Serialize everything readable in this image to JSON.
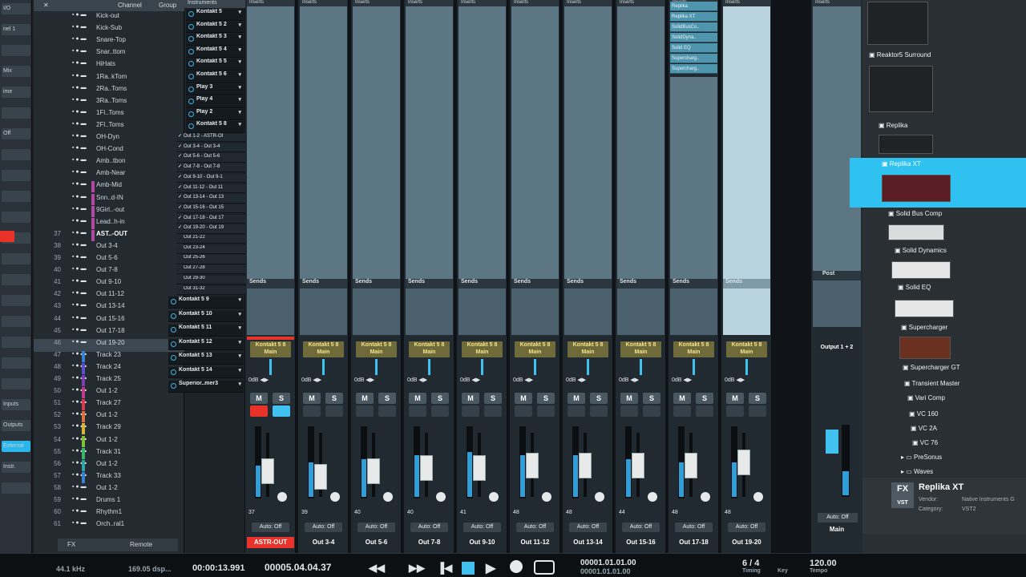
{
  "left_panel": {
    "labels": [
      "I/O",
      "nel 1",
      "",
      "Mix",
      "ime",
      "",
      "Off",
      "",
      "",
      "",
      "",
      "",
      "",
      "",
      "",
      "",
      "",
      "",
      "",
      "Inputs",
      "Outputs",
      "External",
      "Instr.",
      ""
    ]
  },
  "channel_list": {
    "header": {
      "close": "✕",
      "channel": "Channel",
      "group": "Group"
    },
    "rows": [
      {
        "num": "",
        "name": "Kick-out"
      },
      {
        "num": "",
        "name": "Kick-Sub"
      },
      {
        "num": "",
        "name": "Snare-Top"
      },
      {
        "num": "",
        "name": "Snar..ttom"
      },
      {
        "num": "",
        "name": "HiHats"
      },
      {
        "num": "",
        "name": "1Ra..kTom"
      },
      {
        "num": "",
        "name": "2Ra..Toms"
      },
      {
        "num": "",
        "name": "3Ra..Toms"
      },
      {
        "num": "",
        "name": "1Fl..Toms"
      },
      {
        "num": "",
        "name": "2Fl..Toms"
      },
      {
        "num": "",
        "name": "OH-Dyn"
      },
      {
        "num": "",
        "name": "OH-Cond"
      },
      {
        "num": "",
        "name": "Amb..tbon"
      },
      {
        "num": "",
        "name": "Amb-Near"
      },
      {
        "num": "",
        "name": "Amb-Mid"
      },
      {
        "num": "",
        "name": "Snn..d-IN"
      },
      {
        "num": "",
        "name": "9Girl..-out"
      },
      {
        "num": "",
        "name": "Lead..h-in"
      },
      {
        "num": "37",
        "name": "AST..-OUT"
      },
      {
        "num": "38",
        "name": "Out 3-4"
      },
      {
        "num": "39",
        "name": "Out 5-6"
      },
      {
        "num": "40",
        "name": "Out 7-8"
      },
      {
        "num": "41",
        "name": "Out 9-10"
      },
      {
        "num": "42",
        "name": "Out 11-12"
      },
      {
        "num": "43",
        "name": "Out 13-14"
      },
      {
        "num": "44",
        "name": "Out 15-16"
      },
      {
        "num": "45",
        "name": "Out 17-18"
      },
      {
        "num": "46",
        "name": "Out 19-20"
      },
      {
        "num": "47",
        "name": "Track 23"
      },
      {
        "num": "48",
        "name": "Track 24"
      },
      {
        "num": "49",
        "name": "Track 25"
      },
      {
        "num": "50",
        "name": "Out 1-2"
      },
      {
        "num": "51",
        "name": "Track 27"
      },
      {
        "num": "52",
        "name": "Out 1-2"
      },
      {
        "num": "53",
        "name": "Track 29"
      },
      {
        "num": "54",
        "name": "Out 1-2"
      },
      {
        "num": "55",
        "name": "Track 31"
      },
      {
        "num": "56",
        "name": "Out 1-2"
      },
      {
        "num": "57",
        "name": "Track 33"
      },
      {
        "num": "58",
        "name": "Out 1-2"
      },
      {
        "num": "59",
        "name": "Drums 1"
      },
      {
        "num": "60",
        "name": "Rhythm1"
      },
      {
        "num": "61",
        "name": "Orch..ral1"
      }
    ],
    "footer": {
      "remote": "Remote",
      "fx": "FX"
    }
  },
  "instruments": {
    "header": "Instruments",
    "items_top": [
      "Kontakt 5",
      "Kontakt 5 2",
      "Kontakt 5 3",
      "Kontakt 5 4",
      "Kontakt 5 5",
      "Kontakt 5 6",
      "Play 3",
      "Play 4",
      "Play 2",
      "Kontakt 5 8"
    ],
    "outputs": [
      "Out 1-2 - ASTR-OI",
      "Out 3-4 - Out 3-4",
      "Out 5-6 - Out 5-6",
      "Out 7-8 - Out 7-8",
      "Out 9-10 - Out 9-1",
      "Out 11-12 - Out 11",
      "Out 13-14 - Out 13",
      "Out 15-16 - Out 15",
      "Out 17-18 - Out 17",
      "Out 19-20 - Out 19",
      "Out 21-22",
      "Out 23-24",
      "Out 25-26",
      "Out 27-28",
      "Out 29-30",
      "Out 31-32"
    ],
    "checked_count": 10,
    "items_bottom": [
      "Kontakt 5 9",
      "Kontakt 5 10",
      "Kontakt 5 11",
      "Kontakt 5 12",
      "Kontakt 5 13",
      "Kontakt 5 14",
      "Superior..mer3"
    ]
  },
  "mixer": {
    "inserts_label": "Inserts",
    "sends_label": "Sends",
    "main_label": "Main",
    "auto_label": "Auto: Off",
    "m_label": "M",
    "s_label": "S",
    "strips": [
      {
        "bus": "Kontakt 5 8",
        "volume": "37",
        "out": "ASTR-OUT",
        "out_color": "#e8322a",
        "fader": 0.55,
        "meter": 0.45
      },
      {
        "bus": "Kontakt 5 8",
        "volume": "39",
        "out": "Out 3-4",
        "out_color": "",
        "fader": 0.45,
        "meter": 0.5
      },
      {
        "bus": "Kontakt 5 8",
        "volume": "40",
        "out": "Out 5-6",
        "out_color": "",
        "fader": 0.55,
        "meter": 0.55
      },
      {
        "bus": "Kontakt 5 8",
        "volume": "40",
        "out": "Out 7-8",
        "out_color": "",
        "fader": 0.6,
        "meter": 0.6
      },
      {
        "bus": "Kontakt 5 8",
        "volume": "41",
        "out": "Out 9-10",
        "out_color": "",
        "fader": 0.6,
        "meter": 0.65
      },
      {
        "bus": "Kontakt 5 8",
        "volume": "48",
        "out": "Out 11-12",
        "out_color": "",
        "fader": 0.65,
        "meter": 0.6
      },
      {
        "bus": "Kontakt 5 8",
        "volume": "48",
        "out": "Out 13-14",
        "out_color": "",
        "fader": 0.65,
        "meter": 0.6
      },
      {
        "bus": "Kontakt 5 8",
        "volume": "44",
        "out": "Out 15-16",
        "out_color": "",
        "fader": 0.65,
        "meter": 0.55
      },
      {
        "bus": "Kontakt 5 8",
        "volume": "48",
        "out": "Out 17-18",
        "out_color": "",
        "fader": 0.65,
        "meter": 0.5
      },
      {
        "bus": "Kontakt 5 8",
        "volume": "48",
        "out": "Out 19-20",
        "out_color": "",
        "fader": 0.7,
        "meter": 0.5
      }
    ],
    "fx_slots": [
      "Replika",
      "Replika XT",
      "SolidBusCo..",
      "SolidDyna..",
      "Solid EQ",
      "Supercharg..",
      "Supercharg.."
    ],
    "main_out": {
      "inserts": "Inserts",
      "post": "Post",
      "output": "Output 1 + 2",
      "auto": "Auto: Off",
      "label": "Main"
    }
  },
  "browser": {
    "items": [
      {
        "name": "Reaktor5 Surround",
        "type": "fx"
      },
      {
        "name": "Replika",
        "type": "fx"
      },
      {
        "name": "Replika XT",
        "type": "fx",
        "selected": true
      },
      {
        "name": "Solid Bus Comp",
        "type": "fx"
      },
      {
        "name": "Solid Dynamics",
        "type": "fx"
      },
      {
        "name": "Solid EQ",
        "type": "fx"
      },
      {
        "name": "Supercharger",
        "type": "fx"
      },
      {
        "name": "Supercharger GT",
        "type": "fx"
      },
      {
        "name": "Transient Master",
        "type": "fx"
      },
      {
        "name": "Vari Comp",
        "type": "fx"
      },
      {
        "name": "VC 160",
        "type": "fx"
      },
      {
        "name": "VC 2A",
        "type": "fx"
      },
      {
        "name": "VC 76",
        "type": "fx"
      },
      {
        "name": "PreSonus",
        "type": "folder"
      },
      {
        "name": "Waves",
        "type": "folder"
      }
    ],
    "info": {
      "fx": "FX",
      "vst": "VST",
      "title": "Replika XT",
      "vendor_label": "Vendor:",
      "vendor": "Native Instruments G",
      "category_label": "Category:",
      "category": "VST2"
    }
  },
  "transport": {
    "sample_rate": "44.1 kHz",
    "dsp": "169.05 dsp...",
    "time": "00:00:13.991",
    "position": "00005.04.04.37",
    "locator": "00001.01.01.00",
    "locator2": "00001.01.01.00",
    "signature": "6 / 4",
    "tempo": "120.00",
    "timing_label": "Timing",
    "key_label": "Key",
    "tempo_label": "Tempo"
  },
  "colors": {
    "accent": "#29b6ea",
    "selected_browser": "#2fc1f0",
    "astr_out": "#e8322a",
    "bus_label": "#f3e48a"
  }
}
